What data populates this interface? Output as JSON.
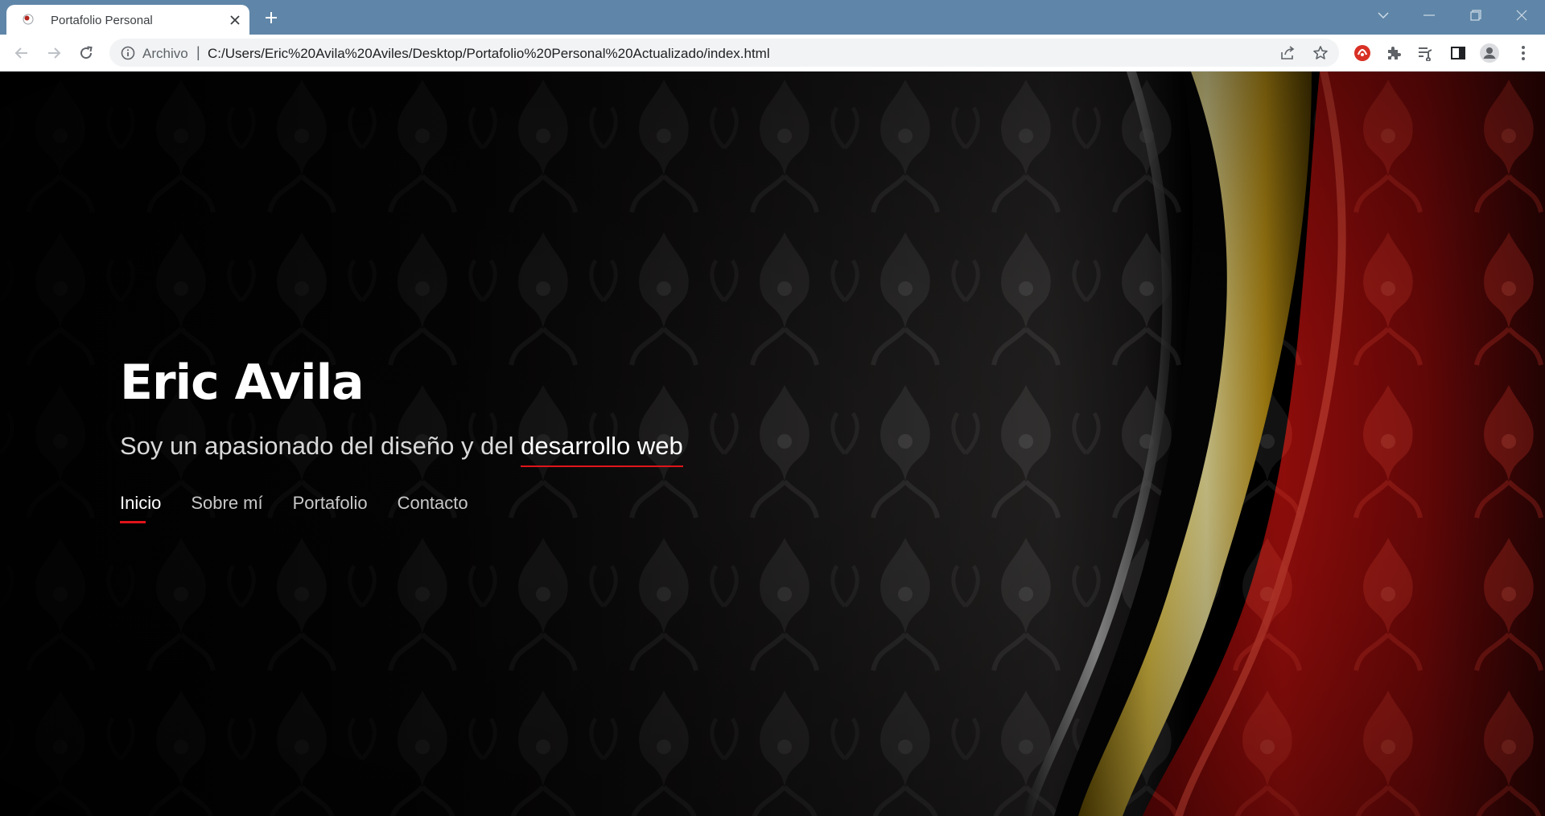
{
  "browser": {
    "tab_title": "Portafolio Personal",
    "omnibox_label": "Archivo",
    "omnibox_separator": "|",
    "url": "C:/Users/Eric%20Avila%20Aviles/Desktop/Portafolio%20Personal%20Actualizado/index.html",
    "icons": [
      "back-icon",
      "forward-icon",
      "reload-icon",
      "info-icon",
      "share-icon",
      "star-icon",
      "extension-icon",
      "puzzle-icon",
      "reading-list-icon",
      "side-panel-icon",
      "profile-icon",
      "menu-icon"
    ],
    "titlebar_color": "#5f86a8"
  },
  "hero": {
    "name": "Eric Avila",
    "tagline_prefix": "Soy un apasionado del diseño y del ",
    "tagline_highlight": "desarrollo web",
    "accent_color": "#e0141a",
    "nav": [
      {
        "label": "Inicio",
        "active": true
      },
      {
        "label": "Sobre mí",
        "active": false
      },
      {
        "label": "Portafolio",
        "active": false
      },
      {
        "label": "Contacto",
        "active": false
      }
    ]
  }
}
